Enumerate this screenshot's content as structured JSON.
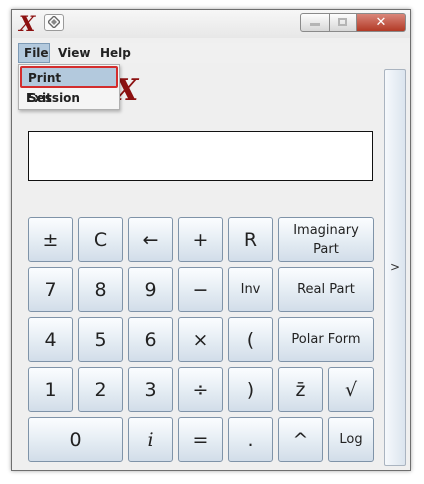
{
  "window": {
    "logo_glyph": "X",
    "close_glyph": "✕"
  },
  "menubar": {
    "items": [
      "File",
      "View",
      "Help"
    ]
  },
  "file_menu": {
    "items": [
      "Print Session",
      "Exit"
    ],
    "highlighted": "Print Session"
  },
  "display": {
    "value": ""
  },
  "side_panel": {
    "arrow": ">"
  },
  "keys": {
    "plus_minus": "±",
    "clear": "C",
    "backspace": "←",
    "plus": "+",
    "recall": "R",
    "imaginary_part_line1": "Imaginary",
    "imaginary_part_line2": "Part",
    "seven": "7",
    "eight": "8",
    "nine": "9",
    "minus": "−",
    "inv": "Inv",
    "real_part": "Real Part",
    "four": "4",
    "five": "5",
    "six": "6",
    "times": "×",
    "open_paren": "(",
    "polar_form": "Polar Form",
    "one": "1",
    "two": "2",
    "three": "3",
    "divide": "÷",
    "close_paren": ")",
    "conjugate": "z̄",
    "sqrt": "√",
    "zero": "0",
    "imag_unit": "i",
    "equals": "=",
    "dot": ".",
    "power": "^",
    "log": "Log"
  },
  "colors": {
    "brand": "#8c1010",
    "menu_highlight": "#b3c9dd",
    "focus_outline": "#d32d2d"
  }
}
